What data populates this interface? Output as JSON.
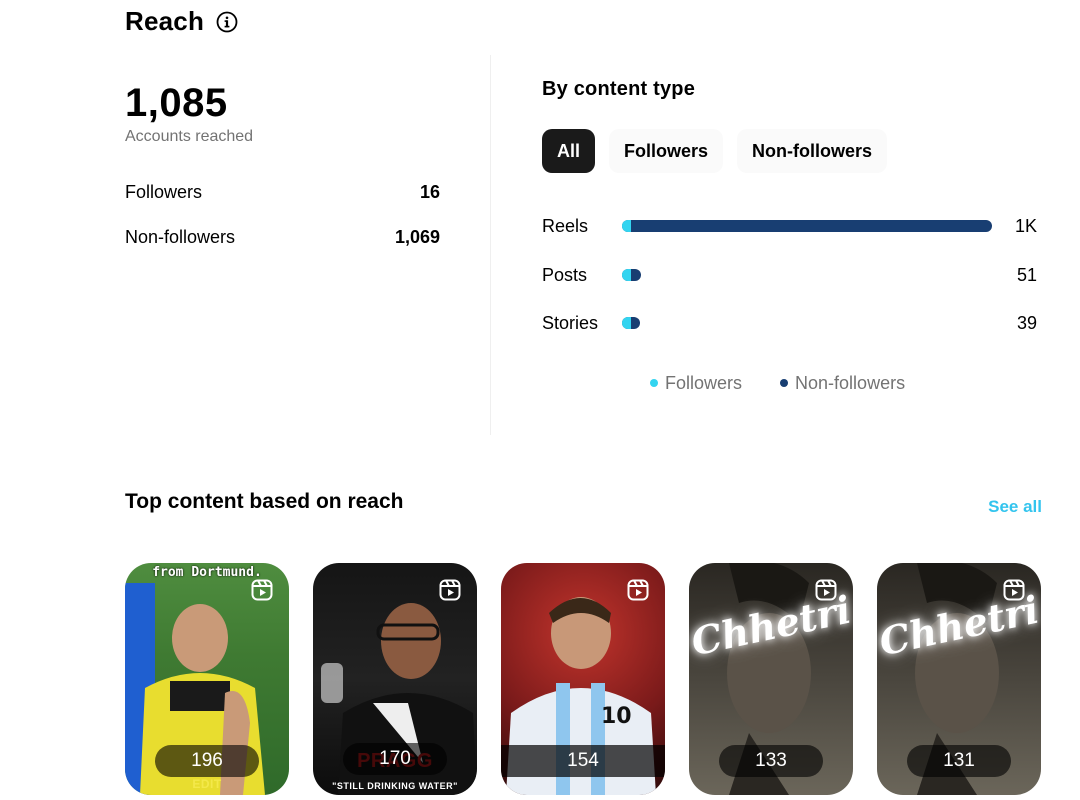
{
  "reach": {
    "title": "Reach",
    "accounts_reached": "1,085",
    "accounts_reached_label": "Accounts reached",
    "breakdown": [
      {
        "label": "Followers",
        "value": "16"
      },
      {
        "label": "Non-followers",
        "value": "1,069"
      }
    ]
  },
  "by_content_type": {
    "title": "By content type",
    "filters": [
      "All",
      "Followers",
      "Non-followers"
    ],
    "active_filter": "All",
    "rows": [
      {
        "label": "Reels",
        "value_text": "1K",
        "followers": 16,
        "non_followers": 1000,
        "bar_fraction": 1.0
      },
      {
        "label": "Posts",
        "value_text": "51",
        "bar_fraction": 0.05
      },
      {
        "label": "Stories",
        "value_text": "39",
        "bar_fraction": 0.035
      }
    ],
    "legend": [
      "Followers",
      "Non-followers"
    ],
    "colors": {
      "followers": "#33d4f0",
      "non_followers": "#183e72"
    }
  },
  "top_content": {
    "title": "Top content based on reach",
    "see_all": "See all",
    "items": [
      {
        "count": "196",
        "overlay_top": "from Dortmund.",
        "overlay_bottom": "EDIT"
      },
      {
        "count": "170",
        "overlay_bottom": "\"STILL DRINKING WATER\"",
        "overlay_text": "PRAGG"
      },
      {
        "count": "154"
      },
      {
        "count": "133",
        "overlay_text": "Chhetri"
      },
      {
        "count": "131",
        "overlay_text": "Chhetri"
      }
    ]
  },
  "icons": [
    "info-icon",
    "reel-icon"
  ]
}
